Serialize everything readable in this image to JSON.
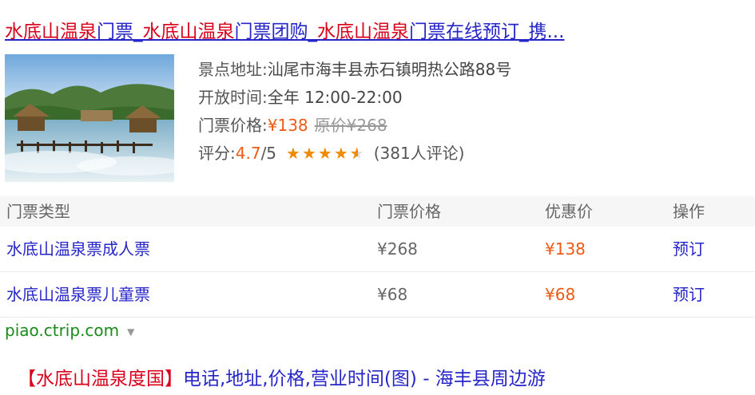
{
  "result": {
    "title_parts": [
      {
        "text": "水底山温泉",
        "hl": true
      },
      {
        "text": "门票_",
        "hl": false
      },
      {
        "text": "水底山温泉",
        "hl": true
      },
      {
        "text": "门票团购_",
        "hl": false
      },
      {
        "text": "水底山温泉",
        "hl": true
      },
      {
        "text": "门票在线预订_携...",
        "hl": false
      }
    ],
    "info": {
      "address_label": "景点地址:",
      "address": "汕尾市海丰县赤石镇明热公路88号",
      "hours_label": "开放时间:",
      "hours": "全年 12:00-22:00",
      "price_label": "门票价格:",
      "price": "¥138",
      "original_price": "原价¥268",
      "rating_label": "评分:",
      "rating": "4.7",
      "rating_max": "/5",
      "rating_stars": 4.5,
      "reviews": "(381人评论)"
    },
    "table": {
      "headers": [
        "门票类型",
        "门票价格",
        "优惠价",
        "操作"
      ],
      "rows": [
        {
          "type": "水底山温泉票成人票",
          "price": "¥268",
          "discount": "¥138",
          "action": "预订"
        },
        {
          "type": "水底山温泉票儿童票",
          "price": "¥68",
          "discount": "¥68",
          "action": "预订"
        }
      ]
    },
    "url": "piao.ctrip.com"
  },
  "next_result": {
    "title_hl": "【水底山温泉度国】",
    "title_rest": "电话,地址,价格,营业时间(图) - 海丰县周边游"
  },
  "colors": {
    "link": "#2626c8",
    "highlight": "#d9001b",
    "price": "#f05a14",
    "url": "#1a8a1a",
    "star": "#f08a00"
  }
}
